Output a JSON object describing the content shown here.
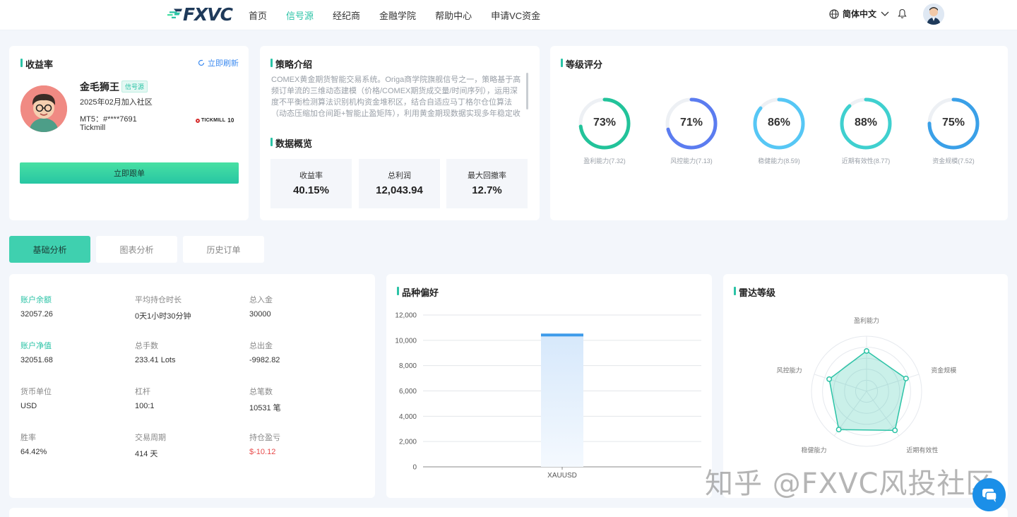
{
  "header": {
    "logo_text": "FXVC",
    "nav": [
      "首页",
      "信号源",
      "经纪商",
      "金融学院",
      "帮助中心",
      "申请VC资金"
    ],
    "active_nav": "信号源",
    "language": "简体中文"
  },
  "profile_card": {
    "title": "收益率",
    "refresh_label": "立即刷新",
    "name": "金毛狮王",
    "tag": "信号源",
    "joined": "2025年02月加入社区",
    "account": "MT5：#****7691",
    "broker": "Tickmill",
    "broker_logo_text": "TICKMILL",
    "broker_logo_badge": "10",
    "follow_button": "立即跟单"
  },
  "strategy_card": {
    "title": "策略介绍",
    "description": "COMEX黄金期货智能交易系统。Origa商学院旗舰信号之一，策略基于高频订单流的三维动态建模（价格/COMEX期货成交量/时间序列），运用深度不平衡检测算法识别机构资金堆积区，结合自适应马丁格尔仓位算法（动态压缩加仓间距+智能止盈矩阵），利用黄金期现数据实现多年稳定收益。",
    "overview_title": "数据概览",
    "stats": [
      {
        "label": "收益率",
        "value": "40.15%"
      },
      {
        "label": "总利润",
        "value": "12,043.94"
      },
      {
        "label": "最大回撤率",
        "value": "12.7%"
      }
    ]
  },
  "rating_card": {
    "title": "等级评分",
    "gauges": [
      {
        "value": "73%",
        "percent": 73,
        "label": "盈利能力(7.32)",
        "color": "#22c39a"
      },
      {
        "value": "71%",
        "percent": 71,
        "label": "风控能力(7.13)",
        "color": "#5b7cf0"
      },
      {
        "value": "86%",
        "percent": 86,
        "label": "稳健能力(8.59)",
        "color": "#56c7f5"
      },
      {
        "value": "88%",
        "percent": 88,
        "label": "近期有效性(8.77)",
        "color": "#3fd0cf"
      },
      {
        "value": "75%",
        "percent": 75,
        "label": "资金规模(7.52)",
        "color": "#3aa0e8"
      }
    ]
  },
  "tabs": [
    "基础分析",
    "图表分析",
    "历史订单"
  ],
  "metrics": [
    {
      "label": "账户余额",
      "value": "32057.26",
      "label_color": "green"
    },
    {
      "label": "平均持仓时长",
      "value": "0天1小时30分钟"
    },
    {
      "label": "总入金",
      "value": "30000"
    },
    {
      "label": "账户净值",
      "value": "32051.68",
      "label_color": "green"
    },
    {
      "label": "总手数",
      "value": "233.41 Lots"
    },
    {
      "label": "总出金",
      "value": "-9982.82"
    },
    {
      "label": "货币单位",
      "value": "USD"
    },
    {
      "label": "杠杆",
      "value": "100:1"
    },
    {
      "label": "总笔数",
      "value": "10531 笔"
    },
    {
      "label": "胜率",
      "value": "64.42%"
    },
    {
      "label": "交易周期",
      "value": "414 天"
    },
    {
      "label": "持仓盈亏",
      "value": "$-10.12",
      "value_color": "red"
    }
  ],
  "variety_card": {
    "title": "品种偏好"
  },
  "chart_data": [
    {
      "type": "bar",
      "title": "品种偏好",
      "categories": [
        "XAUUSD"
      ],
      "values": [
        10531
      ],
      "ylim": [
        0,
        12000
      ],
      "yticks": [
        "0",
        "2,000",
        "4,000",
        "6,000",
        "8,000",
        "10,000",
        "12,000"
      ],
      "grid": true,
      "color": "#3d9bea"
    }
  ],
  "radar_card": {
    "title": "雷达等级",
    "axes": [
      "盈利能力",
      "资金规模",
      "近期有效性",
      "稳健能力",
      "风控能力"
    ],
    "values": [
      7.32,
      7.52,
      8.77,
      8.59,
      7.13
    ],
    "max": 10,
    "color": "#2bc3a6"
  },
  "watermark": "知乎 @FXVC风投社区"
}
